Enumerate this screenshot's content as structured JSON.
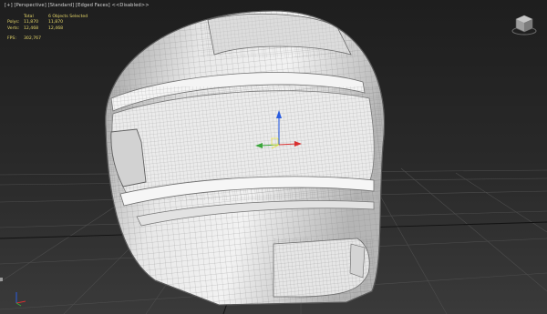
{
  "viewport": {
    "label_parts": [
      "[+]",
      "[Perspective]",
      "[Standard]",
      "[Edged Faces]",
      "<<Disabled>>"
    ]
  },
  "stats": {
    "header": {
      "total": "Total",
      "selected": "6 Objects Selected"
    },
    "polys": {
      "label": "Polys:",
      "total": "11,870",
      "selected": "11,870"
    },
    "verts": {
      "label": "Verts:",
      "total": "12,468",
      "selected": "12,468"
    },
    "fps": {
      "label": "FPS:",
      "value": "302,767"
    }
  },
  "icons": {
    "viewcube": "viewcube-icon",
    "axis_tripod": "axis-tripod-icon",
    "transform_gizmo": "move-gizmo-icon"
  },
  "colors": {
    "stats_text": "#e8d96a",
    "label_text": "#d6d6d6",
    "axis_x": "#d93030",
    "axis_y": "#3aa63a",
    "axis_z": "#2a5de0"
  }
}
